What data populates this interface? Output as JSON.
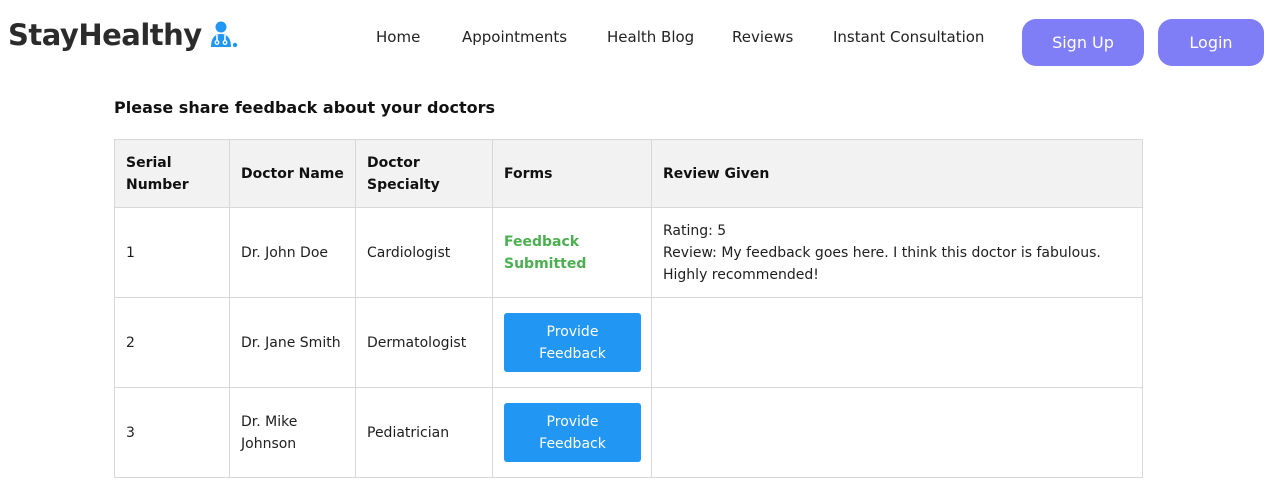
{
  "brand": {
    "name": "StayHealthy",
    "icon": "doctor-icon",
    "icon_color": "#2196f3"
  },
  "nav": {
    "links": [
      "Home",
      "Appointments",
      "Health Blog",
      "Reviews",
      "Instant Consultation"
    ],
    "signup_label": "Sign Up",
    "login_label": "Login"
  },
  "page": {
    "title": "Please share feedback about your doctors"
  },
  "table": {
    "headers": [
      "Serial Number",
      "Doctor Name",
      "Doctor Specialty",
      "Forms",
      "Review Given"
    ],
    "rows": [
      {
        "serial": "1",
        "doctor": "Dr. John Doe",
        "specialty": "Cardiologist",
        "form_status": "Feedback Submitted",
        "rating": "Rating: 5",
        "review": "Review: My feedback goes here. I think this doctor is fabulous. Highly recommended!"
      },
      {
        "serial": "2",
        "doctor": "Dr. Jane Smith",
        "specialty": "Dermatologist",
        "form_button": "Provide Feedback"
      },
      {
        "serial": "3",
        "doctor": "Dr. Mike Johnson",
        "specialty": "Pediatrician",
        "form_button": "Provide Feedback"
      }
    ]
  },
  "colors": {
    "nav_button": "#7f7ef7",
    "feedback_button": "#2196f3",
    "submitted_text": "#4caf50",
    "header_bg": "#f2f2f2"
  }
}
